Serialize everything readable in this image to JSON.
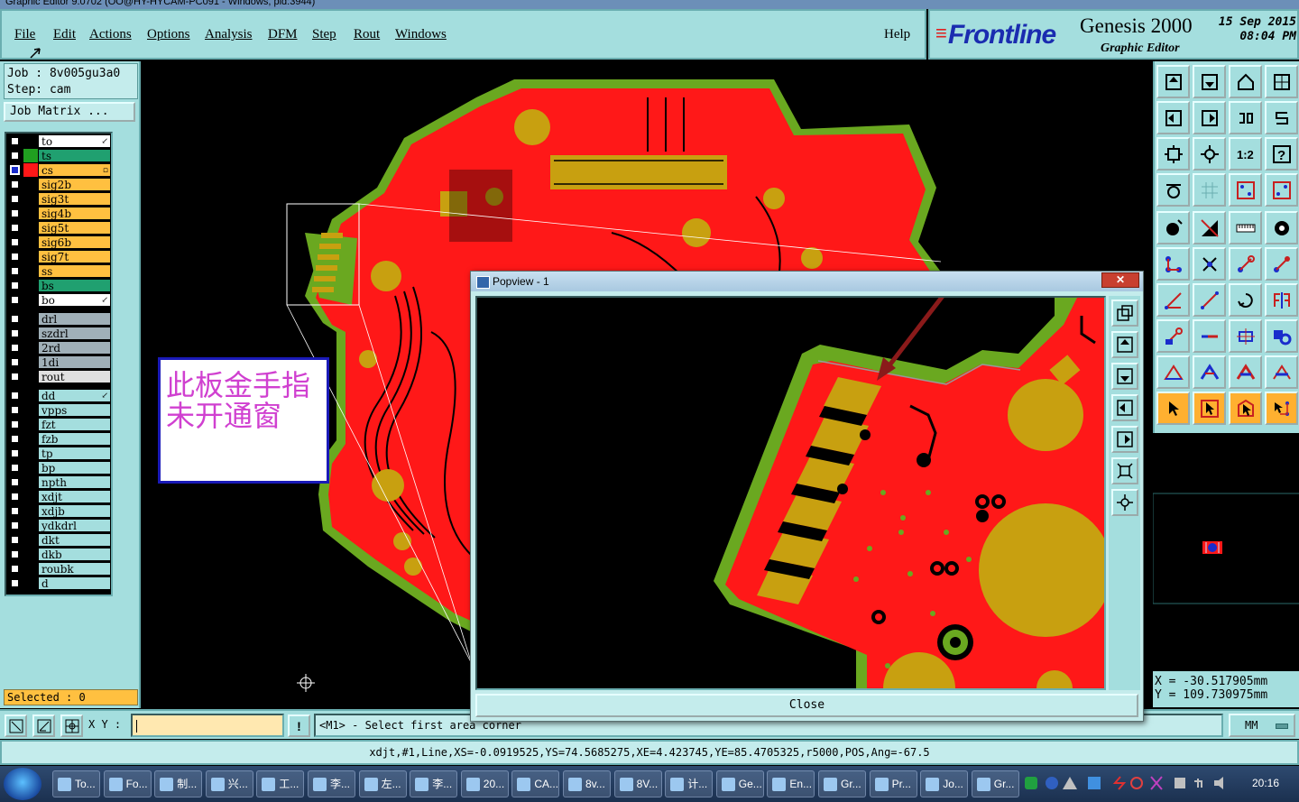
{
  "window_title": "Graphic Editor 9.0702 (OO@HY-HYCAM-PC091 - Windows, pid:3944)",
  "menu": [
    "File",
    "Edit",
    "Actions",
    "Options",
    "Analysis",
    "DFM",
    "Step",
    "Rout",
    "Windows"
  ],
  "help_label": "Help",
  "brand": {
    "logo": "Frontline",
    "app": "Genesis 2000",
    "subtitle": "Graphic Editor",
    "date": "15 Sep 2015",
    "time": "08:04 PM"
  },
  "job": {
    "job_line": "Job : 8v005gu3a0",
    "step_line": "Step: cam"
  },
  "job_matrix_label": "Job Matrix ...",
  "layer_groups": [
    [
      {
        "name": "to",
        "color": "#ffffff",
        "swatch": "#000000",
        "checked": false,
        "mark": "↙"
      },
      {
        "name": "ts",
        "color": "#20a070",
        "swatch": "#20a020",
        "checked": false,
        "mark": ""
      },
      {
        "name": "cs",
        "color": "#ffc040",
        "swatch": "#ff1818",
        "checked": true,
        "mark": "▫"
      },
      {
        "name": "sig2b",
        "color": "#ffc040",
        "swatch": "#000000",
        "checked": false,
        "mark": ""
      },
      {
        "name": "sig3t",
        "color": "#ffc040",
        "swatch": "#000000",
        "checked": false,
        "mark": ""
      },
      {
        "name": "sig4b",
        "color": "#ffc040",
        "swatch": "#000000",
        "checked": false,
        "mark": ""
      },
      {
        "name": "sig5t",
        "color": "#ffc040",
        "swatch": "#000000",
        "checked": false,
        "mark": ""
      },
      {
        "name": "sig6b",
        "color": "#ffc040",
        "swatch": "#000000",
        "checked": false,
        "mark": ""
      },
      {
        "name": "sig7t",
        "color": "#ffc040",
        "swatch": "#000000",
        "checked": false,
        "mark": ""
      },
      {
        "name": "ss",
        "color": "#ffc040",
        "swatch": "#000000",
        "checked": false,
        "mark": ""
      },
      {
        "name": "bs",
        "color": "#20a070",
        "swatch": "#000000",
        "checked": false,
        "mark": ""
      },
      {
        "name": "bo",
        "color": "#ffffff",
        "swatch": "#000000",
        "checked": false,
        "mark": "↙"
      }
    ],
    [
      {
        "name": "drl",
        "color": "#a0b0b8",
        "swatch": "#000000",
        "checked": false,
        "mark": ""
      },
      {
        "name": "szdrl",
        "color": "#a0b0b8",
        "swatch": "#000000",
        "checked": false,
        "mark": ""
      },
      {
        "name": "2rd",
        "color": "#a0b0b8",
        "swatch": "#000000",
        "checked": false,
        "mark": ""
      },
      {
        "name": "1di",
        "color": "#a0b0b8",
        "swatch": "#000000",
        "checked": false,
        "mark": ""
      },
      {
        "name": "rout",
        "color": "#e0e0e0",
        "swatch": "#000000",
        "checked": false,
        "mark": ""
      }
    ],
    [
      {
        "name": "dd",
        "color": "#a4dede",
        "swatch": "#000000",
        "checked": false,
        "mark": "↙"
      },
      {
        "name": "vpps",
        "color": "#a4dede",
        "swatch": "#000000",
        "checked": false,
        "mark": ""
      },
      {
        "name": "fzt",
        "color": "#a4dede",
        "swatch": "#000000",
        "checked": false,
        "mark": ""
      },
      {
        "name": "fzb",
        "color": "#a4dede",
        "swatch": "#000000",
        "checked": false,
        "mark": ""
      },
      {
        "name": "tp",
        "color": "#a4dede",
        "swatch": "#000000",
        "checked": false,
        "mark": ""
      },
      {
        "name": "bp",
        "color": "#a4dede",
        "swatch": "#000000",
        "checked": false,
        "mark": ""
      },
      {
        "name": "npth",
        "color": "#a4dede",
        "swatch": "#000000",
        "checked": false,
        "mark": ""
      },
      {
        "name": "xdjt",
        "color": "#a4dede",
        "swatch": "#000000",
        "checked": false,
        "mark": ""
      },
      {
        "name": "xdjb",
        "color": "#a4dede",
        "swatch": "#000000",
        "checked": false,
        "mark": ""
      },
      {
        "name": "ydkdrl",
        "color": "#a4dede",
        "swatch": "#000000",
        "checked": false,
        "mark": ""
      },
      {
        "name": "dkt",
        "color": "#a4dede",
        "swatch": "#000000",
        "checked": false,
        "mark": ""
      },
      {
        "name": "dkb",
        "color": "#a4dede",
        "swatch": "#000000",
        "checked": false,
        "mark": ""
      },
      {
        "name": "roubk",
        "color": "#a4dede",
        "swatch": "#000000",
        "checked": false,
        "mark": ""
      },
      {
        "name": "d",
        "color": "#a4dede",
        "swatch": "#000000",
        "checked": false,
        "mark": ""
      }
    ]
  ],
  "selected_label": "Selected : 0",
  "annotation": {
    "line1": "此板金手指",
    "line2": "未开通窗"
  },
  "popview": {
    "title": "Popview - 1",
    "close_x": "✕",
    "close_button": "Close"
  },
  "coords": {
    "x": "X = -30.517905mm",
    "y": "Y = 109.730975mm"
  },
  "xy_label": "X Y :",
  "command_message": "<M1> - Select first area corner",
  "units": "MM",
  "info_line": "xdjt,#1,Line,XS=-0.0919525,YS=74.5685275,XE=4.423745,YE=85.4705325,r5000,POS,Ang=-67.5",
  "taskbar": {
    "items": [
      "To...",
      "Fo...",
      "制...",
      "兴...",
      "工...",
      "李...",
      "左...",
      "李...",
      "20...",
      "CA...",
      "8v...",
      "8V...",
      "计...",
      "Ge...",
      "En...",
      "Gr...",
      "Pr...",
      "Jo...",
      "Gr..."
    ],
    "clock": "20:16"
  },
  "colors": {
    "panel": "#a4dede",
    "board_copper": "#ff1818",
    "board_mask": "#6aa820",
    "pad": "#c8a010",
    "highlight": "#ffc040",
    "arrow": "#8a1a1a"
  }
}
